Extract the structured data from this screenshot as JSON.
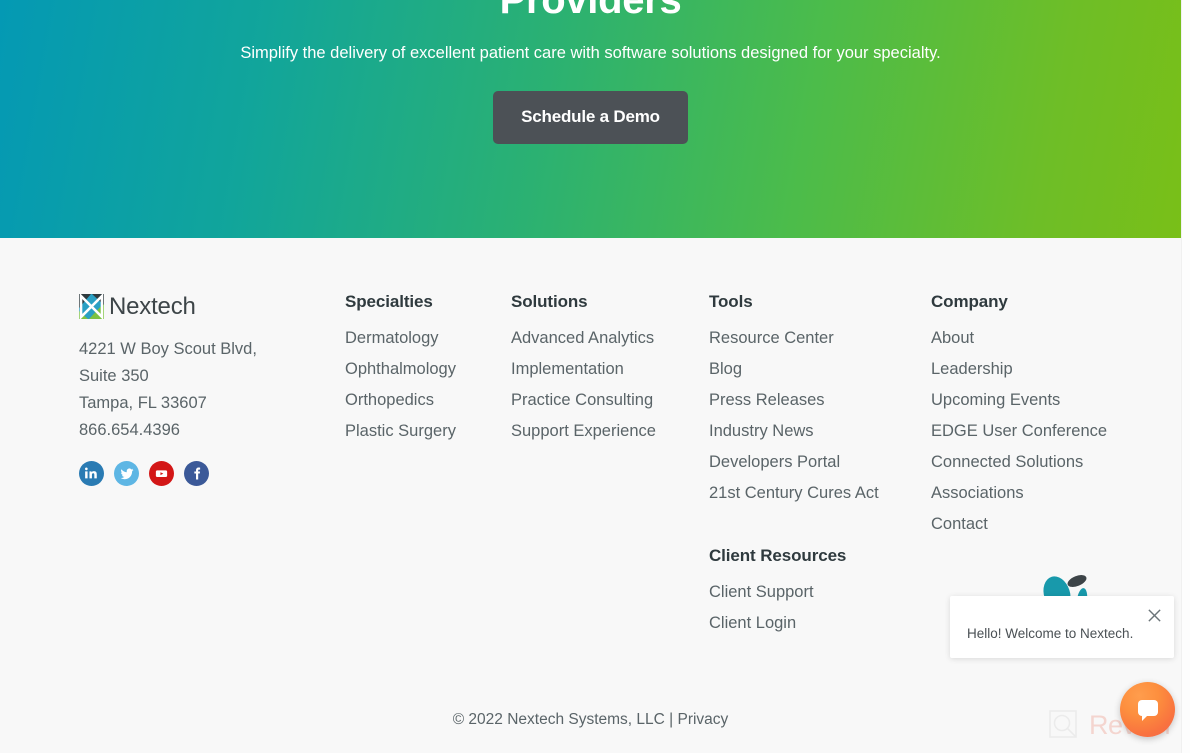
{
  "hero": {
    "title": "Providers",
    "subtitle": "Simplify the delivery of excellent patient care with software solutions designed for your specialty.",
    "cta_label": "Schedule a Demo",
    "gradient_start": "#0499b4",
    "gradient_end": "#79bf18",
    "cta_background": "#4c5156"
  },
  "footer": {
    "background": "#f8f8f8",
    "brand": {
      "logo_text": "Nextech",
      "address_lines": [
        "4221 W Boy Scout Blvd,",
        "Suite 350",
        "Tampa, FL 33607",
        "866.654.4396"
      ],
      "social": [
        {
          "name": "linkedin",
          "label": "LinkedIn",
          "color": "#2a7bb3"
        },
        {
          "name": "twitter",
          "label": "Twitter",
          "color": "#5eb6e4"
        },
        {
          "name": "youtube",
          "label": "YouTube",
          "color": "#d31717"
        },
        {
          "name": "facebook",
          "label": "Facebook",
          "color": "#3b5998"
        }
      ]
    },
    "columns": {
      "specialties": {
        "heading": "Specialties",
        "links": [
          "Dermatology",
          "Ophthalmology",
          "Orthopedics",
          "Plastic Surgery"
        ]
      },
      "solutions": {
        "heading": "Solutions",
        "links": [
          "Advanced Analytics",
          "Implementation",
          "Practice Consulting",
          "Support Experience"
        ]
      },
      "tools": {
        "heading": "Tools",
        "links": [
          "Resource Center",
          "Blog",
          "Press Releases",
          "Industry News",
          "Developers Portal",
          "21st Century Cures Act"
        ]
      },
      "company": {
        "heading": "Company",
        "links": [
          "About",
          "Leadership",
          "Upcoming Events",
          "EDGE User Conference",
          "Connected Solutions",
          "Associations",
          "Contact"
        ]
      },
      "client_resources": {
        "heading": "Client Resources",
        "links": [
          "Client Support",
          "Client Login"
        ]
      }
    },
    "copyright": {
      "text": "© 2022 Nextech Systems, LLC | ",
      "privacy_label": "Privacy"
    }
  },
  "chat": {
    "message": "Hello! Welcome to Nextech.",
    "close_label": "×",
    "fab_color": "#fd8f3e"
  },
  "watermark": {
    "text": "Revain"
  }
}
